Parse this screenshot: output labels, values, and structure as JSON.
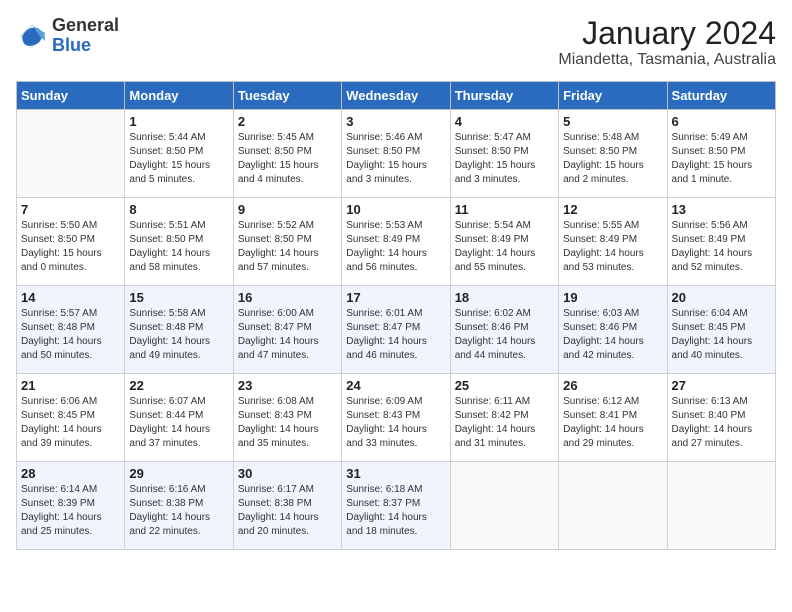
{
  "header": {
    "logo": {
      "general": "General",
      "blue": "Blue"
    },
    "title": "January 2024",
    "location": "Miandetta, Tasmania, Australia"
  },
  "calendar": {
    "days": [
      "Sunday",
      "Monday",
      "Tuesday",
      "Wednesday",
      "Thursday",
      "Friday",
      "Saturday"
    ],
    "weeks": [
      [
        {
          "day": "",
          "sunrise": "",
          "sunset": "",
          "daylight": ""
        },
        {
          "day": "1",
          "sunrise": "Sunrise: 5:44 AM",
          "sunset": "Sunset: 8:50 PM",
          "daylight": "Daylight: 15 hours and 5 minutes."
        },
        {
          "day": "2",
          "sunrise": "Sunrise: 5:45 AM",
          "sunset": "Sunset: 8:50 PM",
          "daylight": "Daylight: 15 hours and 4 minutes."
        },
        {
          "day": "3",
          "sunrise": "Sunrise: 5:46 AM",
          "sunset": "Sunset: 8:50 PM",
          "daylight": "Daylight: 15 hours and 3 minutes."
        },
        {
          "day": "4",
          "sunrise": "Sunrise: 5:47 AM",
          "sunset": "Sunset: 8:50 PM",
          "daylight": "Daylight: 15 hours and 3 minutes."
        },
        {
          "day": "5",
          "sunrise": "Sunrise: 5:48 AM",
          "sunset": "Sunset: 8:50 PM",
          "daylight": "Daylight: 15 hours and 2 minutes."
        },
        {
          "day": "6",
          "sunrise": "Sunrise: 5:49 AM",
          "sunset": "Sunset: 8:50 PM",
          "daylight": "Daylight: 15 hours and 1 minute."
        }
      ],
      [
        {
          "day": "7",
          "sunrise": "Sunrise: 5:50 AM",
          "sunset": "Sunset: 8:50 PM",
          "daylight": "Daylight: 15 hours and 0 minutes."
        },
        {
          "day": "8",
          "sunrise": "Sunrise: 5:51 AM",
          "sunset": "Sunset: 8:50 PM",
          "daylight": "Daylight: 14 hours and 58 minutes."
        },
        {
          "day": "9",
          "sunrise": "Sunrise: 5:52 AM",
          "sunset": "Sunset: 8:50 PM",
          "daylight": "Daylight: 14 hours and 57 minutes."
        },
        {
          "day": "10",
          "sunrise": "Sunrise: 5:53 AM",
          "sunset": "Sunset: 8:49 PM",
          "daylight": "Daylight: 14 hours and 56 minutes."
        },
        {
          "day": "11",
          "sunrise": "Sunrise: 5:54 AM",
          "sunset": "Sunset: 8:49 PM",
          "daylight": "Daylight: 14 hours and 55 minutes."
        },
        {
          "day": "12",
          "sunrise": "Sunrise: 5:55 AM",
          "sunset": "Sunset: 8:49 PM",
          "daylight": "Daylight: 14 hours and 53 minutes."
        },
        {
          "day": "13",
          "sunrise": "Sunrise: 5:56 AM",
          "sunset": "Sunset: 8:49 PM",
          "daylight": "Daylight: 14 hours and 52 minutes."
        }
      ],
      [
        {
          "day": "14",
          "sunrise": "Sunrise: 5:57 AM",
          "sunset": "Sunset: 8:48 PM",
          "daylight": "Daylight: 14 hours and 50 minutes."
        },
        {
          "day": "15",
          "sunrise": "Sunrise: 5:58 AM",
          "sunset": "Sunset: 8:48 PM",
          "daylight": "Daylight: 14 hours and 49 minutes."
        },
        {
          "day": "16",
          "sunrise": "Sunrise: 6:00 AM",
          "sunset": "Sunset: 8:47 PM",
          "daylight": "Daylight: 14 hours and 47 minutes."
        },
        {
          "day": "17",
          "sunrise": "Sunrise: 6:01 AM",
          "sunset": "Sunset: 8:47 PM",
          "daylight": "Daylight: 14 hours and 46 minutes."
        },
        {
          "day": "18",
          "sunrise": "Sunrise: 6:02 AM",
          "sunset": "Sunset: 8:46 PM",
          "daylight": "Daylight: 14 hours and 44 minutes."
        },
        {
          "day": "19",
          "sunrise": "Sunrise: 6:03 AM",
          "sunset": "Sunset: 8:46 PM",
          "daylight": "Daylight: 14 hours and 42 minutes."
        },
        {
          "day": "20",
          "sunrise": "Sunrise: 6:04 AM",
          "sunset": "Sunset: 8:45 PM",
          "daylight": "Daylight: 14 hours and 40 minutes."
        }
      ],
      [
        {
          "day": "21",
          "sunrise": "Sunrise: 6:06 AM",
          "sunset": "Sunset: 8:45 PM",
          "daylight": "Daylight: 14 hours and 39 minutes."
        },
        {
          "day": "22",
          "sunrise": "Sunrise: 6:07 AM",
          "sunset": "Sunset: 8:44 PM",
          "daylight": "Daylight: 14 hours and 37 minutes."
        },
        {
          "day": "23",
          "sunrise": "Sunrise: 6:08 AM",
          "sunset": "Sunset: 8:43 PM",
          "daylight": "Daylight: 14 hours and 35 minutes."
        },
        {
          "day": "24",
          "sunrise": "Sunrise: 6:09 AM",
          "sunset": "Sunset: 8:43 PM",
          "daylight": "Daylight: 14 hours and 33 minutes."
        },
        {
          "day": "25",
          "sunrise": "Sunrise: 6:11 AM",
          "sunset": "Sunset: 8:42 PM",
          "daylight": "Daylight: 14 hours and 31 minutes."
        },
        {
          "day": "26",
          "sunrise": "Sunrise: 6:12 AM",
          "sunset": "Sunset: 8:41 PM",
          "daylight": "Daylight: 14 hours and 29 minutes."
        },
        {
          "day": "27",
          "sunrise": "Sunrise: 6:13 AM",
          "sunset": "Sunset: 8:40 PM",
          "daylight": "Daylight: 14 hours and 27 minutes."
        }
      ],
      [
        {
          "day": "28",
          "sunrise": "Sunrise: 6:14 AM",
          "sunset": "Sunset: 8:39 PM",
          "daylight": "Daylight: 14 hours and 25 minutes."
        },
        {
          "day": "29",
          "sunrise": "Sunrise: 6:16 AM",
          "sunset": "Sunset: 8:38 PM",
          "daylight": "Daylight: 14 hours and 22 minutes."
        },
        {
          "day": "30",
          "sunrise": "Sunrise: 6:17 AM",
          "sunset": "Sunset: 8:38 PM",
          "daylight": "Daylight: 14 hours and 20 minutes."
        },
        {
          "day": "31",
          "sunrise": "Sunrise: 6:18 AM",
          "sunset": "Sunset: 8:37 PM",
          "daylight": "Daylight: 14 hours and 18 minutes."
        },
        {
          "day": "",
          "sunrise": "",
          "sunset": "",
          "daylight": ""
        },
        {
          "day": "",
          "sunrise": "",
          "sunset": "",
          "daylight": ""
        },
        {
          "day": "",
          "sunrise": "",
          "sunset": "",
          "daylight": ""
        }
      ]
    ]
  }
}
